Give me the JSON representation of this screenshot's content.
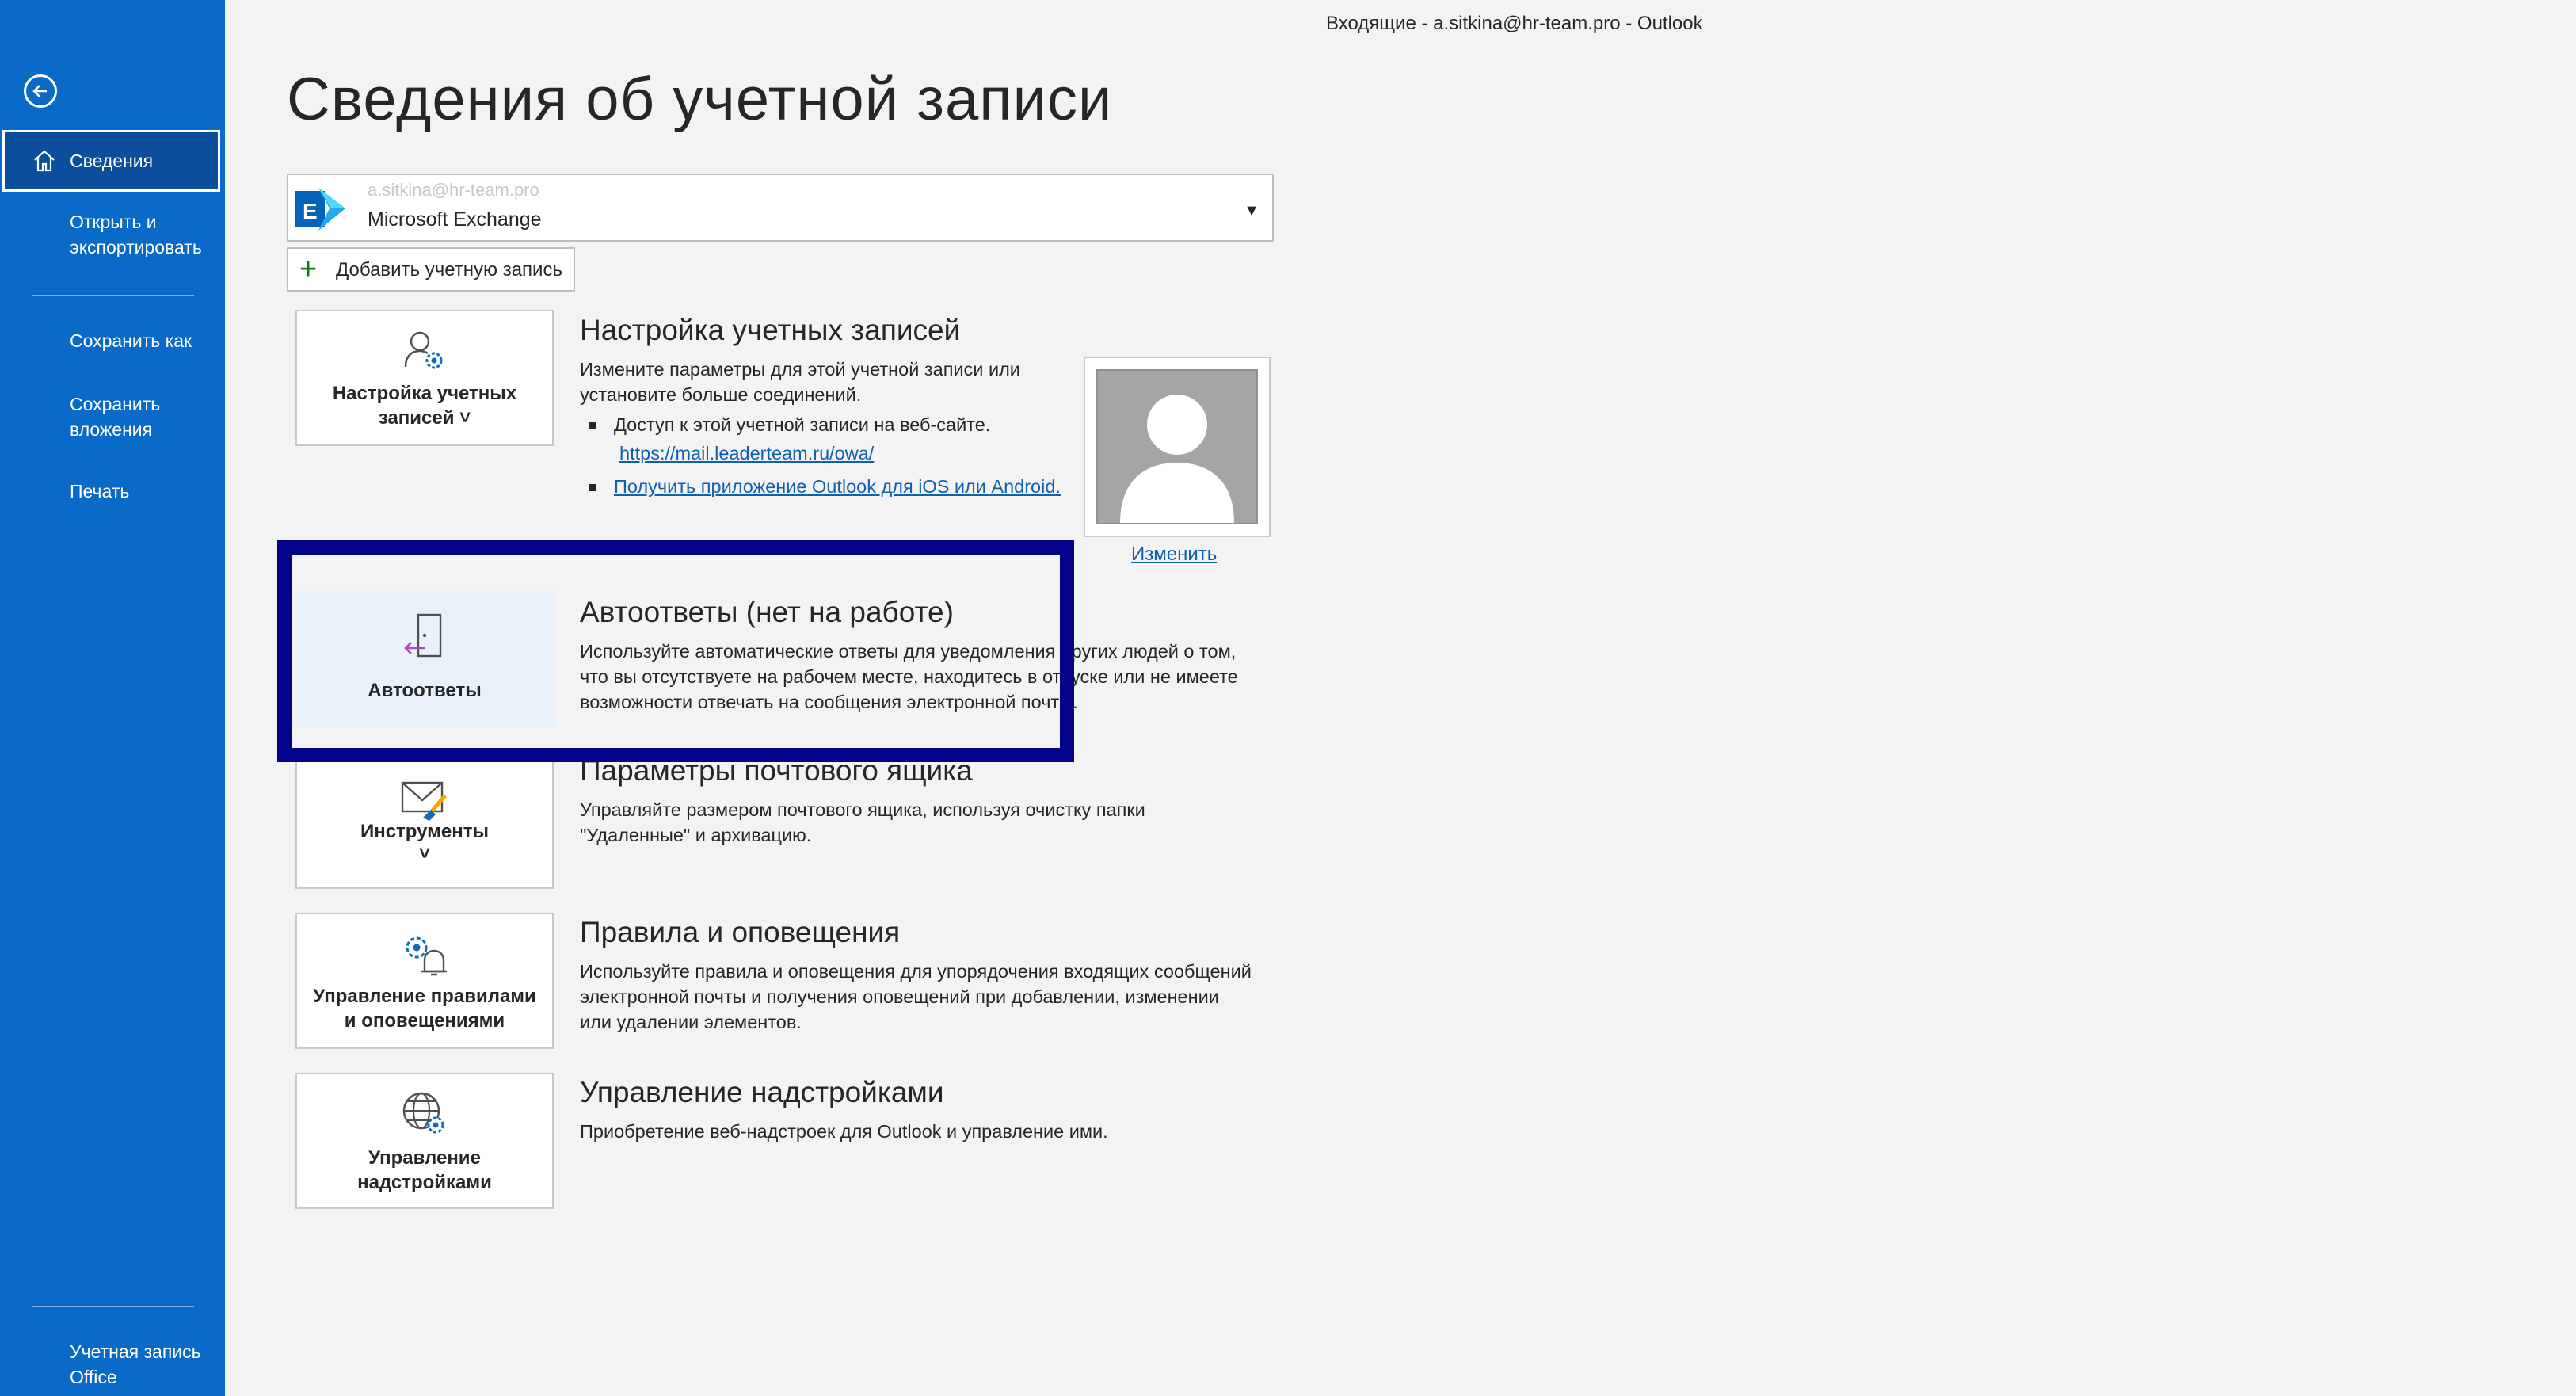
{
  "window_title": "Входящие - a.sitkina@hr-team.pro  -  Outlook",
  "page_title": "Сведения об учетной записи",
  "sidebar": {
    "back_icon": "arrow-left-circle-icon",
    "items": [
      {
        "label": "Сведения",
        "active": true,
        "icon": "home-icon"
      },
      {
        "label": "Открыть и\nэкспортировать"
      },
      {
        "label": "Сохранить как"
      },
      {
        "label": "Сохранить\nвложения"
      },
      {
        "label": "Печать"
      }
    ],
    "footer": "Учетная запись\nOffice"
  },
  "account": {
    "name": "a.sitkina@hr-team.pro",
    "type": "Microsoft Exchange",
    "icon": "exchange-icon"
  },
  "add_account_label": "Добавить учетную запись",
  "sections": {
    "account_settings": {
      "tile_label": "Настройка учетных\nзаписей ˅",
      "title": "Настройка учетных записей",
      "desc_lines": [
        "Измените параметры для этой учетной записи или",
        "установите больше соединений."
      ],
      "bullet1_text": "Доступ к этой учетной записи на веб-сайте.",
      "bullet1_link": "https://mail.leaderteam.ru/owa/",
      "bullet2_link": "Получить приложение Outlook для iOS или Android."
    },
    "auto_replies": {
      "tile_label": "Автоответы",
      "title": "Автоответы (нет на работе)",
      "desc_lines": [
        "Используйте автоматические ответы для уведомления других людей о том,",
        "что вы отсутствуете на рабочем месте, находитесь в отпуске или не имеете",
        "возможности отвечать на сообщения электронной почты."
      ]
    },
    "mailbox": {
      "tile_label": "Инструменты\n˅",
      "title": "Параметры почтового ящика",
      "desc_lines": [
        "Управляйте размером почтового ящика, используя очистку папки",
        "\"Удаленные\" и архивацию."
      ]
    },
    "rules": {
      "tile_label": "Управление правилами\nи оповещениями",
      "title": "Правила и оповещения",
      "desc_lines": [
        "Используйте правила и оповещения для упорядочения входящих сообщений",
        "электронной почты и получения оповещений при добавлении, изменении",
        "или удалении элементов."
      ]
    },
    "addins": {
      "tile_label": "Управление\nнадстройками",
      "title": "Управление надстройками",
      "desc_lines": [
        "Приобретение веб-надстроек для Outlook и управление ими."
      ]
    }
  },
  "photo_change_link": "Изменить",
  "colors": {
    "sidebar": "#0a6ac8",
    "highlight": "#02028a",
    "link": "#0f5fb3"
  }
}
